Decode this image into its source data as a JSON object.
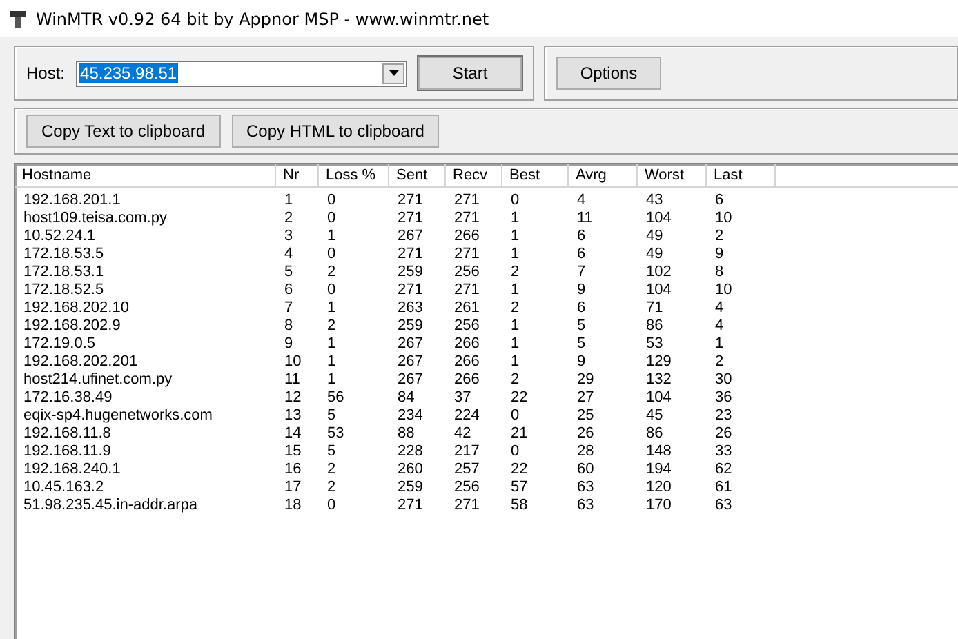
{
  "window": {
    "title": "WinMTR v0.92 64 bit by Appnor MSP - www.winmtr.net"
  },
  "host": {
    "label": "Host:",
    "value": "45.235.98.51",
    "text_selected": true
  },
  "buttons": {
    "start": "Start",
    "options": "Options",
    "copy_text": "Copy Text to clipboard",
    "copy_html": "Copy HTML to clipboard"
  },
  "table": {
    "columns": [
      "Hostname",
      "Nr",
      "Loss %",
      "Sent",
      "Recv",
      "Best",
      "Avrg",
      "Worst",
      "Last"
    ],
    "rows": [
      [
        "192.168.201.1",
        "1",
        "0",
        "271",
        "271",
        "0",
        "4",
        "43",
        "6"
      ],
      [
        "host109.teisa.com.py",
        "2",
        "0",
        "271",
        "271",
        "1",
        "11",
        "104",
        "10"
      ],
      [
        "10.52.24.1",
        "3",
        "1",
        "267",
        "266",
        "1",
        "6",
        "49",
        "2"
      ],
      [
        "172.18.53.5",
        "4",
        "0",
        "271",
        "271",
        "1",
        "6",
        "49",
        "9"
      ],
      [
        "172.18.53.1",
        "5",
        "2",
        "259",
        "256",
        "2",
        "7",
        "102",
        "8"
      ],
      [
        "172.18.52.5",
        "6",
        "0",
        "271",
        "271",
        "1",
        "9",
        "104",
        "10"
      ],
      [
        "192.168.202.10",
        "7",
        "1",
        "263",
        "261",
        "2",
        "6",
        "71",
        "4"
      ],
      [
        "192.168.202.9",
        "8",
        "2",
        "259",
        "256",
        "1",
        "5",
        "86",
        "4"
      ],
      [
        "172.19.0.5",
        "9",
        "1",
        "267",
        "266",
        "1",
        "5",
        "53",
        "1"
      ],
      [
        "192.168.202.201",
        "10",
        "1",
        "267",
        "266",
        "1",
        "9",
        "129",
        "2"
      ],
      [
        "host214.ufinet.com.py",
        "11",
        "1",
        "267",
        "266",
        "2",
        "29",
        "132",
        "30"
      ],
      [
        "172.16.38.49",
        "12",
        "56",
        "84",
        "37",
        "22",
        "27",
        "104",
        "36"
      ],
      [
        "eqix-sp4.hugenetworks.com",
        "13",
        "5",
        "234",
        "224",
        "0",
        "25",
        "45",
        "23"
      ],
      [
        "192.168.11.8",
        "14",
        "53",
        "88",
        "42",
        "21",
        "26",
        "86",
        "26"
      ],
      [
        "192.168.11.9",
        "15",
        "5",
        "228",
        "217",
        "0",
        "28",
        "148",
        "33"
      ],
      [
        "192.168.240.1",
        "16",
        "2",
        "260",
        "257",
        "22",
        "60",
        "194",
        "62"
      ],
      [
        "10.45.163.2",
        "17",
        "2",
        "259",
        "256",
        "57",
        "63",
        "120",
        "61"
      ],
      [
        "51.98.235.45.in-addr.arpa",
        "18",
        "0",
        "271",
        "271",
        "58",
        "63",
        "170",
        "63"
      ]
    ]
  }
}
